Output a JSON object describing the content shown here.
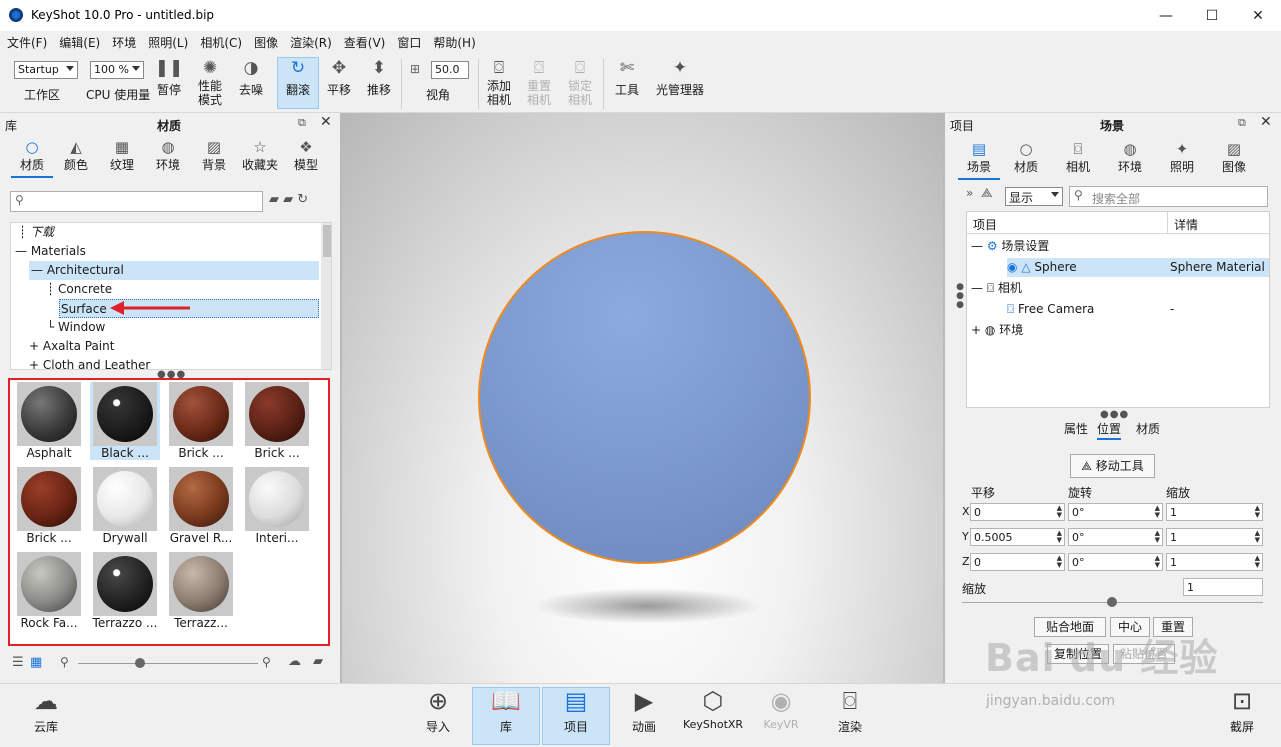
{
  "window": {
    "title": "KeyShot 10.0 Pro  - untitled.bip",
    "minimize": "—",
    "maximize": "☐",
    "close": "✕"
  },
  "menu": [
    "文件(F)",
    "编辑(E)",
    "环境",
    "照明(L)",
    "相机(C)",
    "图像",
    "渲染(R)",
    "查看(V)",
    "窗口",
    "帮助(H)"
  ],
  "toolbar": {
    "workspace_select": "Startup",
    "workspace_label": "工作区",
    "cpu_select": "100 %",
    "cpu_label": "CPU 使用量",
    "pause": "暂停",
    "perf_mode": "性能\n模式",
    "denoise": "去噪",
    "tumble": "翻滚",
    "pan": "平移",
    "dolly": "推移",
    "fov_value": "50.0",
    "fov_label": "视角",
    "add_camera": "添加\n相机",
    "reset_camera": "重置\n相机",
    "lock_camera": "锁定\n相机",
    "tools": "工具",
    "light_manager": "光管理器"
  },
  "library": {
    "panel_label": "库",
    "title": "材质",
    "tabs": [
      "材质",
      "颜色",
      "纹理",
      "环境",
      "背景",
      "收藏夹",
      "模型"
    ],
    "search_placeholder": "",
    "tree": [
      "下载",
      "Materials",
      "Architectural",
      "Concrete",
      "Surface",
      "Window",
      "Axalta Paint",
      "Cloth and Leather"
    ],
    "thumbnails": [
      {
        "label": "Asphalt",
        "color": "#3a3a3a"
      },
      {
        "label": "Black ...",
        "color": "#1c1c1c"
      },
      {
        "label": "Brick ...",
        "color": "#6b2a17"
      },
      {
        "label": "Brick ...",
        "color": "#5a2116"
      },
      {
        "label": "Brick ...",
        "color": "#6a2414"
      },
      {
        "label": "Drywall",
        "color": "#e8e8e8"
      },
      {
        "label": "Gravel R...",
        "color": "#7a3a1e"
      },
      {
        "label": "Interi...",
        "color": "#dcdcdc"
      },
      {
        "label": "Rock Fa...",
        "color": "#8a8a86"
      },
      {
        "label": "Terrazzo ...",
        "color": "#222222"
      },
      {
        "label": "Terrazz...",
        "color": "#8c7c70"
      }
    ],
    "highlight_color": "#e0212b",
    "selection_color": "#cce4f7"
  },
  "project": {
    "panel_label": "项目",
    "title": "场景",
    "tabs": [
      "场景",
      "材质",
      "相机",
      "环境",
      "照明",
      "图像"
    ],
    "display_select": "显示",
    "search_placeholder": "搜索全部",
    "columns": [
      "项目",
      "详情"
    ],
    "rows": [
      {
        "name": "场景设置",
        "detail": ""
      },
      {
        "name": "Sphere",
        "detail": "Sphere Material"
      },
      {
        "name": "相机",
        "detail": ""
      },
      {
        "name": "Free Camera",
        "detail": "-"
      },
      {
        "name": "环境",
        "detail": ""
      }
    ],
    "subtabs": [
      "属性",
      "位置",
      "材质"
    ],
    "move_tool": "移动工具",
    "headers": [
      "平移",
      "旋转",
      "缩放"
    ],
    "axes": [
      "X",
      "Y",
      "Z"
    ],
    "translate": [
      "0",
      "0.5005",
      "0"
    ],
    "rotate": [
      "0°",
      "0°",
      "0°"
    ],
    "scale": [
      "1",
      "1",
      "1"
    ],
    "uniform_scale_label": "缩放",
    "uniform_scale": "1",
    "buttons": [
      "贴合地面",
      "中心",
      "重置",
      "复制位置",
      "粘贴位置"
    ]
  },
  "viewport": {
    "sphere_color": "#7e9bd0",
    "outline_color": "#f08a1c"
  },
  "dock": [
    "云库",
    "导入",
    "库",
    "项目",
    "动画",
    "KeyShotXR",
    "KeyVR",
    "渲染",
    "截屏"
  ],
  "watermark": {
    "brand": "Bai du 经验",
    "url": "jingyan.baidu.com"
  }
}
